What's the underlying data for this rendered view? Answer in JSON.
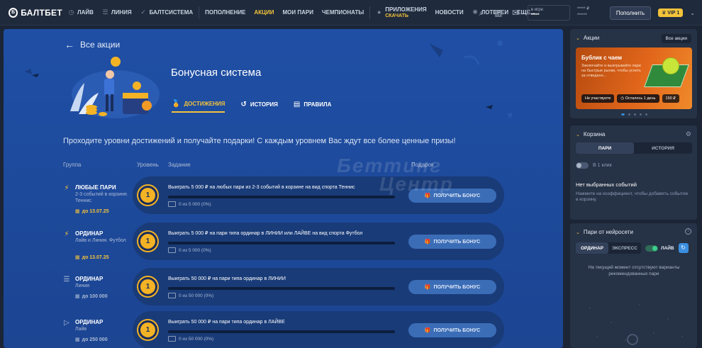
{
  "nav": {
    "logo_mark": "Б",
    "logo": "БАЛТБЕТ",
    "items": [
      {
        "label": "ЛАЙВ",
        "icon": "clock-icon"
      },
      {
        "label": "ЛИНИЯ",
        "icon": "lines-icon"
      },
      {
        "label": "БАЛТСИСТЕМА",
        "icon": "system-icon"
      }
    ],
    "items2": [
      "ПОПОЛНЕНИЕ",
      "АКЦИИ",
      "МОИ ПАРИ",
      "ЧЕМПИОНАТЫ"
    ],
    "apps_label": "ПРИЛОЖЕНИЯ",
    "apps_sub": "СКАЧАТЬ",
    "items3": [
      "НОВОСТИ",
      "ЛОТЕРЕИ",
      "ЕЩЕ..."
    ],
    "active": "АКЦИИ",
    "balance_label": "в игре",
    "balance_value": "*****",
    "stars_top": "***** ₽",
    "stars_bottom": "******",
    "deposit_label": "Пополнить",
    "vip_label": "VIP 1"
  },
  "main": {
    "back_label": "Все акции",
    "title": "Бонусная система",
    "tabs": [
      {
        "label": "ДОСТИЖЕНИЯ",
        "icon": "medal-icon",
        "active": true
      },
      {
        "label": "ИСТОРИЯ",
        "icon": "history-icon",
        "active": false
      },
      {
        "label": "ПРАВИЛА",
        "icon": "rules-icon",
        "active": false
      }
    ],
    "subtitle": "Проходите уровни достижений и получайте подарки! С каждым уровнем Вас ждут все более ценные призы!",
    "col_group": "Группа",
    "col_level": "Уровень",
    "col_task": "Задание",
    "col_reward": "Подарок",
    "watermark_line1": "Беттинг",
    "watermark_line2": "Центр",
    "rows": [
      {
        "icon": "lightning-icon",
        "icon_color": "#f3c33b",
        "name": "ЛЮБЫЕ ПАРИ",
        "desc": "2-3 событий в корзине. Теннис",
        "date": "до 13.07.25",
        "date_color": "#f3c33b",
        "level": "1",
        "task": "Выиграть 5 000 ₽ на любых пари из 2-3 событий в корзине на вид спорта Теннис",
        "progress": "0 из 5 000 (0%)",
        "button": "ПОЛУЧИТЬ БОНУС"
      },
      {
        "icon": "lightning-icon",
        "icon_color": "#f3c33b",
        "name": "ОРДИНАР",
        "desc": "Лайв и Линия. Футбол",
        "date": "до 13.07.25",
        "date_color": "#f3c33b",
        "level": "1",
        "task": "Выиграть 5 000 ₽ на пари типа ординар в ЛИНИИ или ЛАЙВЕ на вид спорта Футбол",
        "progress": "0 из 5 000 (0%)",
        "button": "ПОЛУЧИТЬ БОНУС"
      },
      {
        "icon": "lines-icon",
        "icon_color": "#aebcd6",
        "name": "ОРДИНАР",
        "desc": "Линия",
        "date": "до 100 000",
        "date_color": "#aebcd6",
        "level": "1",
        "task": "Выиграть 50 000 ₽ на пари типа ординар в ЛИНИИ",
        "progress": "0 из 50 000 (0%)",
        "button": "ПОЛУЧИТЬ БОНУС"
      },
      {
        "icon": "play-icon",
        "icon_color": "#aebcd6",
        "name": "ОРДИНАР",
        "desc": "Лайв",
        "date": "до 250 000",
        "date_color": "#aebcd6",
        "level": "1",
        "task": "Выиграть 50 000 ₽ на пари типа ординар в ЛАЙВЕ",
        "progress": "0 из 50 000 (0%)",
        "button": "ПОЛУЧИТЬ БОНУС"
      }
    ]
  },
  "sidebar": {
    "promos": {
      "title": "Акции",
      "all_label": "Все акции",
      "card_title": "Бублик с чаем",
      "card_text": "Заключайте и выигрывайте пари на быстрые рынки, чтобы успеть за отведенн...",
      "tag1": "Не участвуете",
      "tag2": "Осталось 1 день",
      "tag3": "150 ₽"
    },
    "cart": {
      "title": "Корзина",
      "tab1": "ПАРИ",
      "tab2": "ИСТОРИЯ",
      "one_click": "В 1 клик",
      "empty_title": "Нет выбранных событий",
      "empty_text": "Нажмите на коэффициент, чтобы добавить событие в корзину."
    },
    "ai": {
      "title": "Пари от нейросети",
      "tab1": "ОРДИНАР",
      "tab2": "ЭКСПРЕСС",
      "live_label": "ЛАЙВ",
      "empty_text": "На текущий момент отсутствуют варианты рекомендованных пари"
    }
  }
}
